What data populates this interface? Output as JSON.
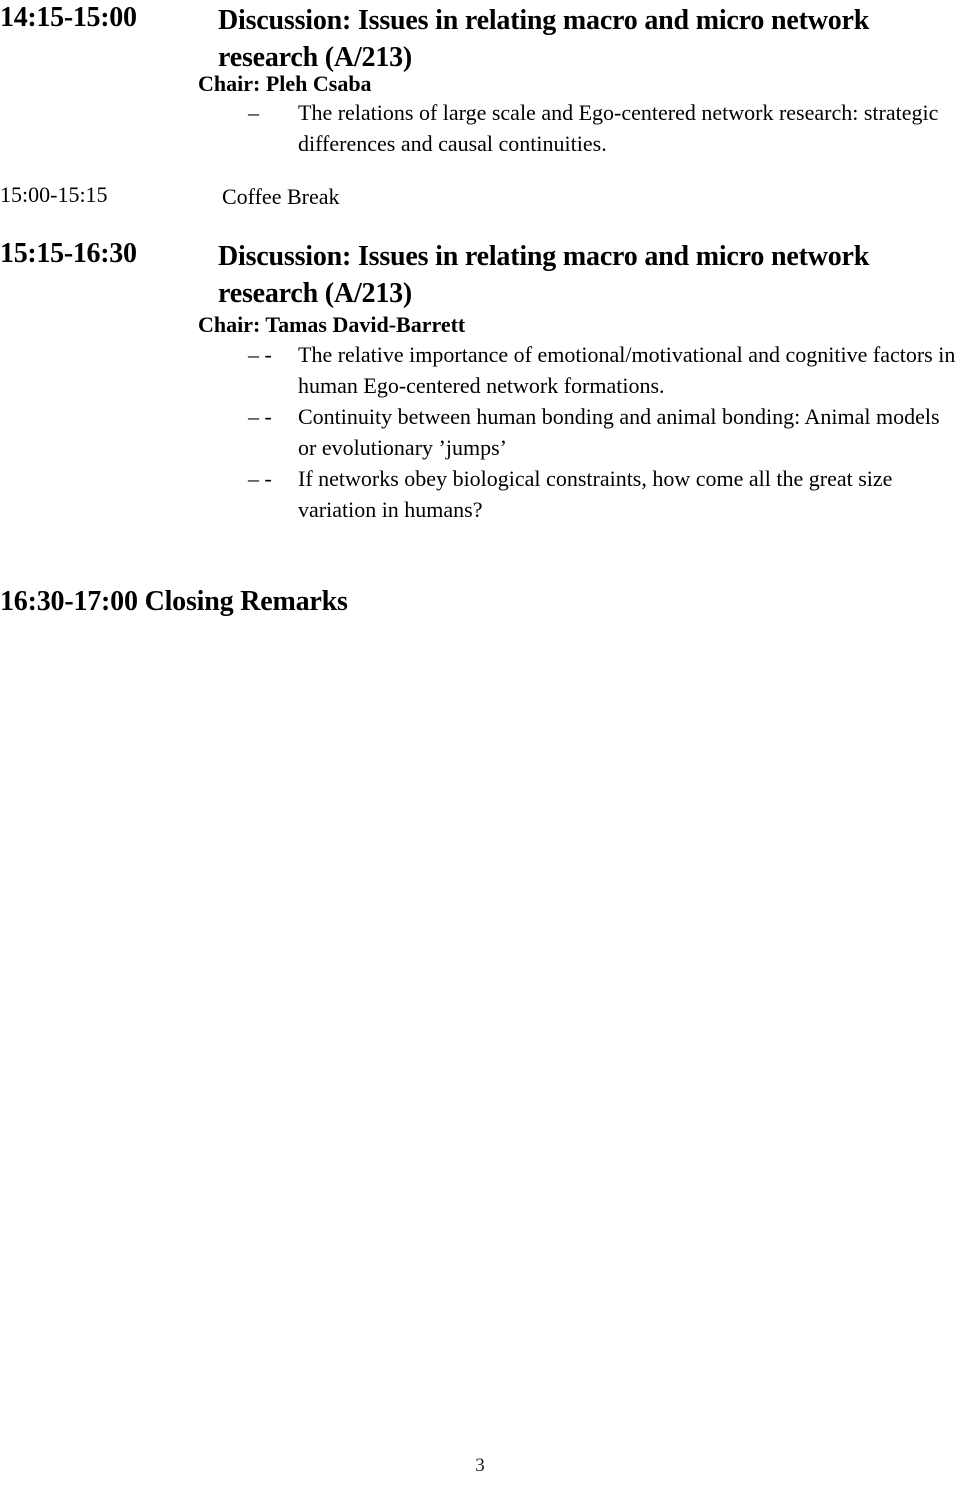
{
  "document": {
    "page_number": "3",
    "sessions": [
      {
        "time": "14:15-15:00",
        "title_line1": "Discussion: Issues in relating macro and micro network",
        "title_line2": "research (A/213)",
        "chair": "Chair: Pleh Csaba",
        "bullets": [
          {
            "marker": "–",
            "text": "The relations of large scale and Ego-centered network research: strategic differences and causal continuities."
          }
        ]
      },
      {
        "time": "15:00-15:15",
        "title": "Coffee Break"
      },
      {
        "time": "15:15-16:30",
        "title_line1": "Discussion: Issues in relating macro and micro network",
        "title_line2": "research (A/213)",
        "chair": "Chair: Tamas David-Barrett",
        "bullets": [
          {
            "marker": "– -",
            "text": "The relative importance of emotional/motivational and cognitive factors in human Ego-centered network formations."
          },
          {
            "marker": "– -",
            "text": "Continuity between human bonding and animal bonding: Animal models or evolutionary ’jumps’"
          },
          {
            "marker": "– -",
            "text": "If networks obey biological constraints, how come all the great size variation in humans?"
          }
        ]
      }
    ],
    "closing": "16:30-17:00 Closing Remarks"
  }
}
